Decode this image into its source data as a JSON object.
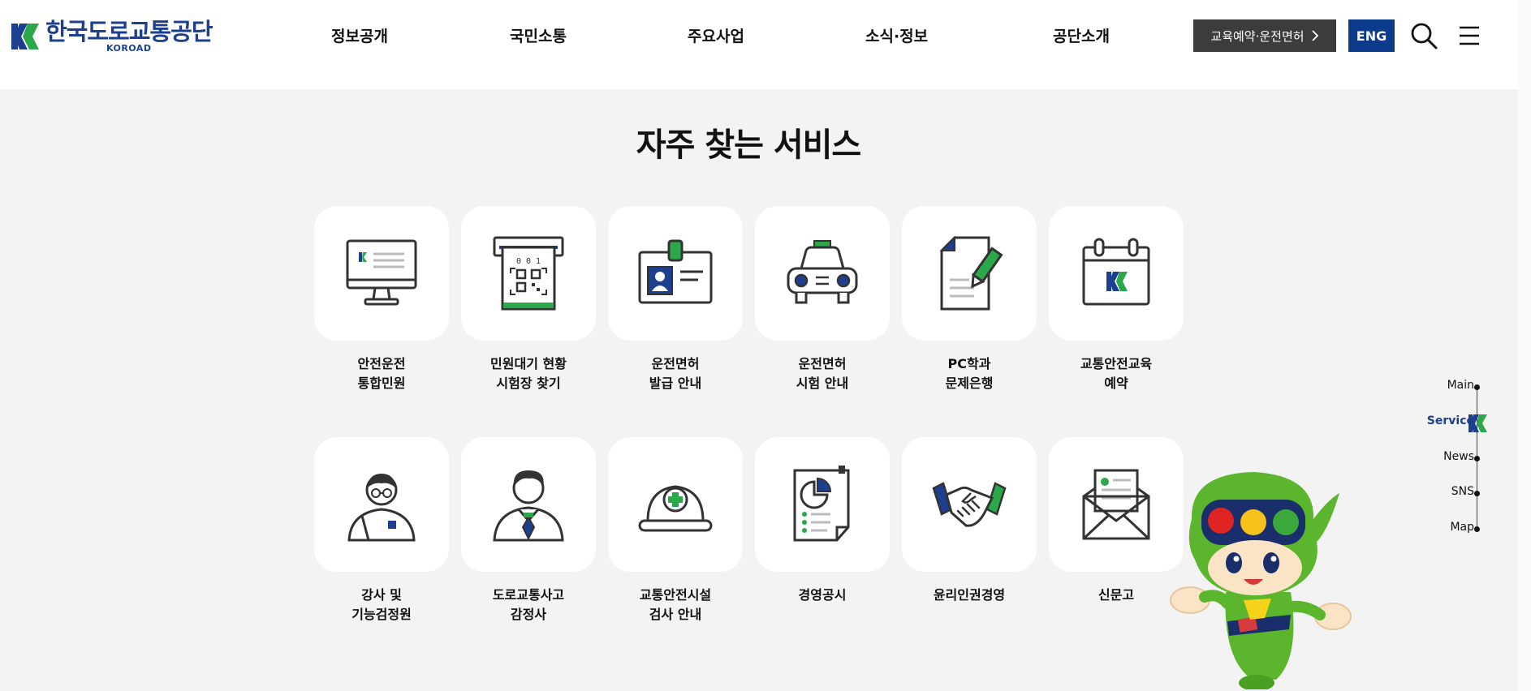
{
  "header": {
    "logo_kor": "한국도로교통공단",
    "logo_eng": "KOROAD",
    "nav": [
      "정보공개",
      "국민소통",
      "주요사업",
      "소식·정보",
      "공단소개"
    ],
    "edu_button": "교육예약·운전면허",
    "eng_button": "ENG",
    "search_icon": "search-icon",
    "menu_icon": "hamburger-menu-icon"
  },
  "main": {
    "title": "자주 찾는 서비스",
    "services": [
      {
        "label": "안전운전\n통합민원",
        "icon": "monitor-icon"
      },
      {
        "label": "민원대기 현황\n시험장 찾기",
        "icon": "queue-ticket-icon"
      },
      {
        "label": "운전면허\n발급 안내",
        "icon": "id-card-icon"
      },
      {
        "label": "운전면허\n시험 안내",
        "icon": "car-icon"
      },
      {
        "label": "PC학과\n문제은행",
        "icon": "document-pen-icon"
      },
      {
        "label": "교통안전교육\n예약",
        "icon": "calendar-icon"
      },
      {
        "label": "강사 및\n기능검정원",
        "icon": "instructor-icon"
      },
      {
        "label": "도로교통사고\n감정사",
        "icon": "businessman-icon"
      },
      {
        "label": "교통안전시설\n검사 안내",
        "icon": "helmet-icon"
      },
      {
        "label": "경영공시",
        "icon": "report-chart-icon"
      },
      {
        "label": "윤리인권경영",
        "icon": "handshake-icon"
      },
      {
        "label": "신문고",
        "icon": "envelope-icon"
      }
    ]
  },
  "side_nav": {
    "items": [
      "Main",
      "Service",
      "News",
      "SNS",
      "Map"
    ],
    "active": "Service"
  },
  "colors": {
    "brand_blue": "#1d3f8f",
    "brand_green": "#2aa84a",
    "eng_button": "#0d3b8c",
    "edu_button": "#3c3c3c",
    "section_bg": "#f3f3f3"
  }
}
